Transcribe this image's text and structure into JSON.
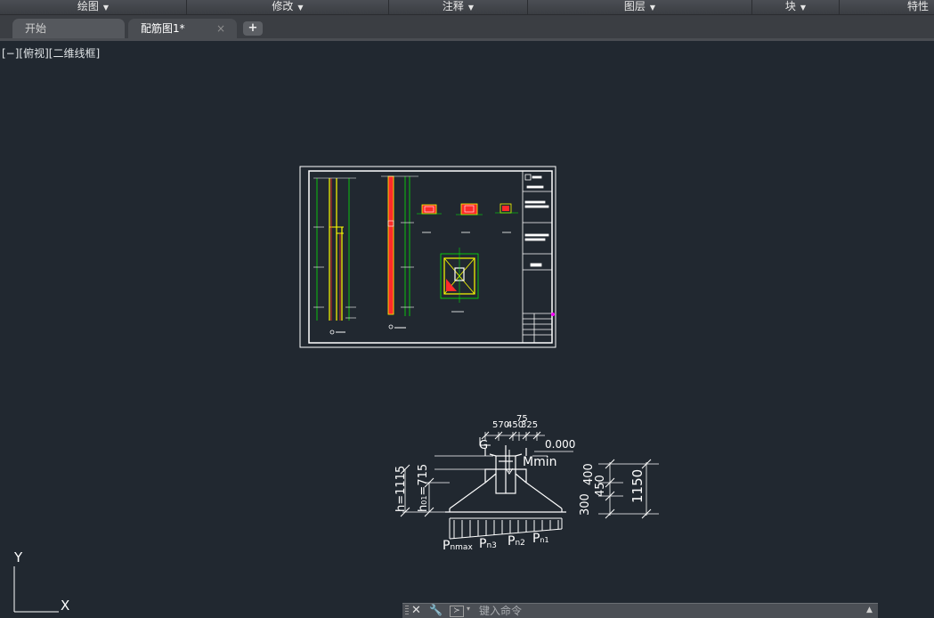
{
  "ribbon": {
    "panels": [
      {
        "label": "绘图"
      },
      {
        "label": "修改"
      },
      {
        "label": "注释"
      },
      {
        "label": "图层"
      },
      {
        "label": "块"
      },
      {
        "label": "特性"
      }
    ],
    "dropdown_glyph": "▼"
  },
  "tabs": {
    "start_label": "开始",
    "drawing_label": "配筋图1*",
    "close_glyph": "×",
    "new_tab_glyph": "+"
  },
  "viewport": {
    "label": "[−][俯视][二维线框]"
  },
  "section": {
    "dim_top_1": "570",
    "dim_top_2": "450",
    "dim_top_3": "325",
    "dim_top_75": "75",
    "elevation": "0.000",
    "mmin": "Mmin",
    "dim_400": "400",
    "dim_450": "450",
    "dim_300": "300",
    "dim_1150": "1150",
    "h_total": "h=1115",
    "h_partial": "h",
    "h_partial_sub": "01",
    "h_partial_val": "=715",
    "g_label": "G",
    "p_max": "P",
    "p_max_sub": "nmax",
    "p_3": "P",
    "p_3_sub": "n3",
    "p_2": "P",
    "p_2_sub": "n2",
    "p_1": "P",
    "p_1_sub": "n1"
  },
  "ucs": {
    "x_label": "X",
    "y_label": "Y"
  },
  "command": {
    "close_glyph": "✕",
    "wrench_glyph": "🔧",
    "prompt_glyph": "≻",
    "dropdown_glyph": "▾",
    "placeholder": "键入命令",
    "scroll_glyph": "▲"
  },
  "colors": {
    "background": "#212830",
    "sheet_border": "#ffffff",
    "rebar_yellow": "#ffff00",
    "rebar_red": "#ff2a2a",
    "dim_green": "#00ff00",
    "marker_magenta": "#ff00ff"
  }
}
